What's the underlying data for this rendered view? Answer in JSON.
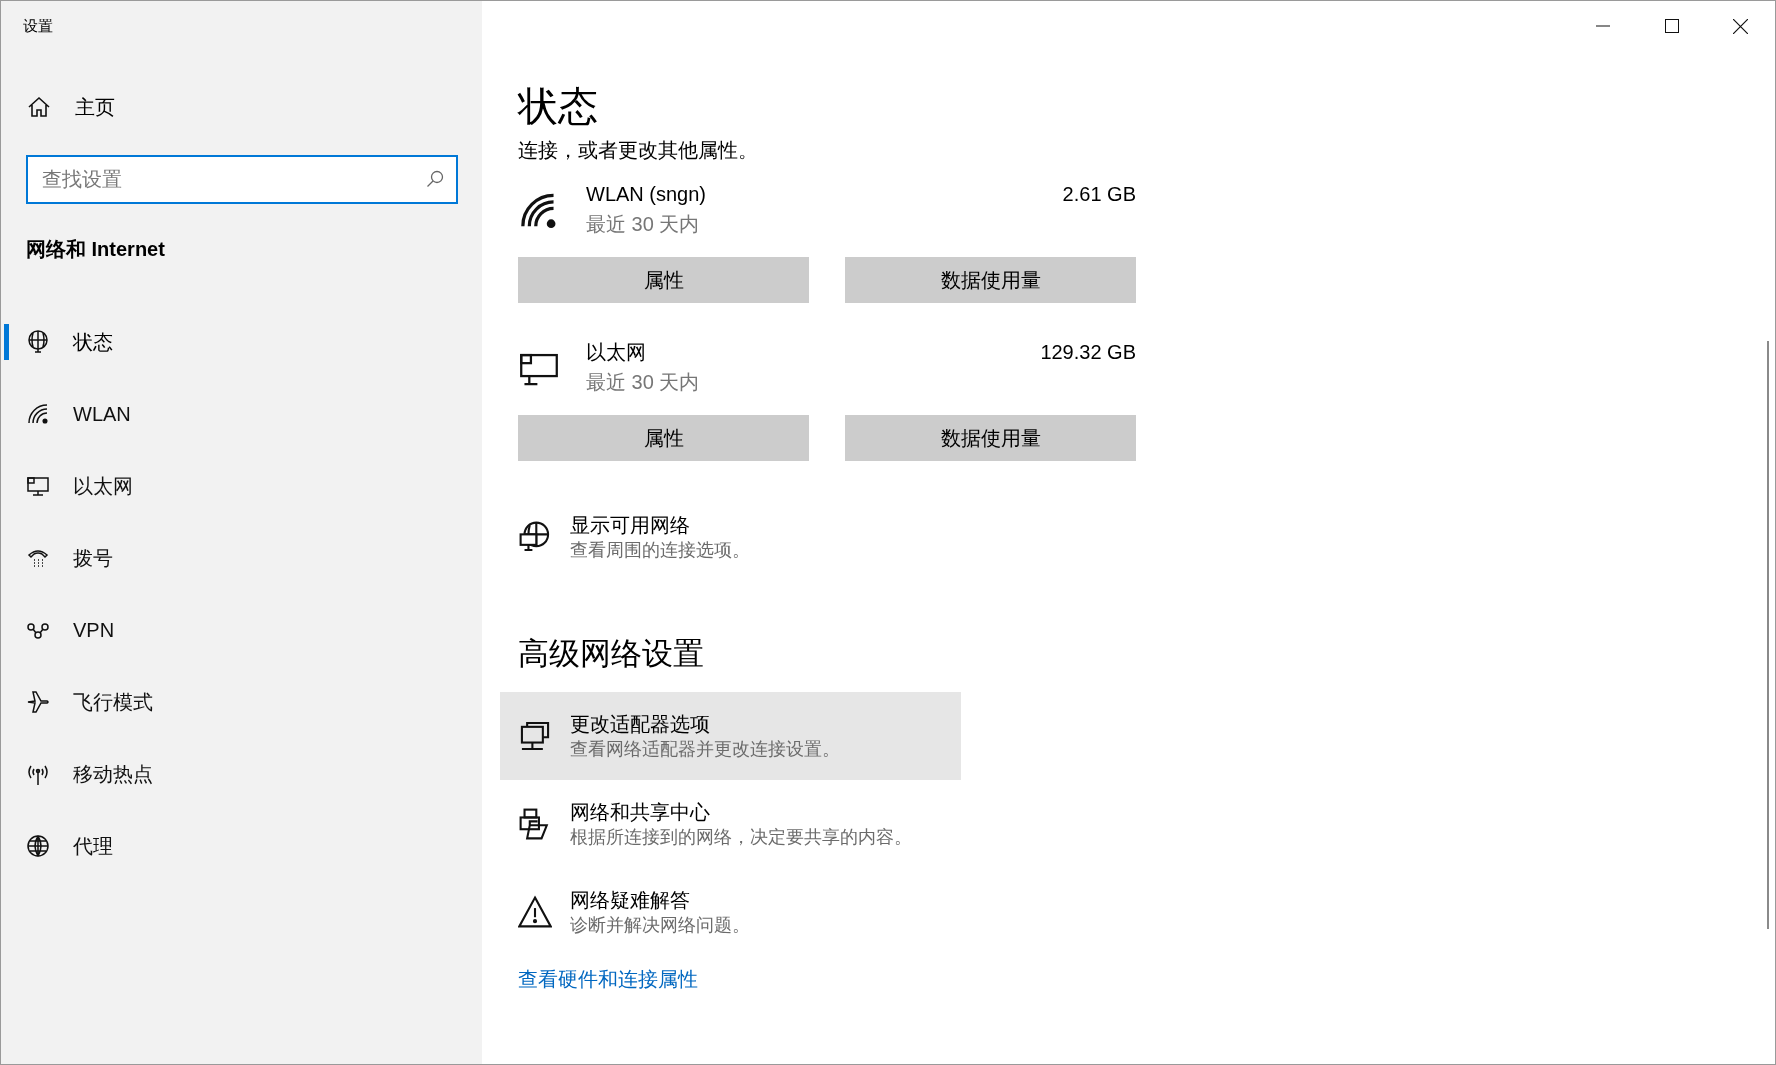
{
  "window": {
    "title": "设置"
  },
  "sidebar": {
    "home": "主页",
    "search": {
      "placeholder": "查找设置"
    },
    "section": "网络和 Internet",
    "items": [
      {
        "label": "状态",
        "selected": true
      },
      {
        "label": "WLAN",
        "selected": false
      },
      {
        "label": "以太网",
        "selected": false
      },
      {
        "label": "拨号",
        "selected": false
      },
      {
        "label": "VPN",
        "selected": false
      },
      {
        "label": "飞行模式",
        "selected": false
      },
      {
        "label": "移动热点",
        "selected": false
      },
      {
        "label": "代理",
        "selected": false
      }
    ]
  },
  "main": {
    "title": "状态",
    "subtitle": "连接，或者更改其他属性。",
    "connections": [
      {
        "name": "WLAN (sngn)",
        "period": "最近 30 天内",
        "usage": "2.61 GB",
        "buttons": [
          "属性",
          "数据使用量"
        ]
      },
      {
        "name": "以太网",
        "period": "最近 30 天内",
        "usage": "129.32 GB",
        "buttons": [
          "属性",
          "数据使用量"
        ]
      }
    ],
    "show_networks": {
      "title": "显示可用网络",
      "description": "查看周围的连接选项。"
    },
    "advanced_heading": "高级网络设置",
    "advanced_items": [
      {
        "title": "更改适配器选项",
        "description": "查看网络适配器并更改连接设置。",
        "hovered": true
      },
      {
        "title": "网络和共享中心",
        "description": "根据所连接到的网络，决定要共享的内容。",
        "hovered": false
      },
      {
        "title": "网络疑难解答",
        "description": "诊断并解决网络问题。",
        "hovered": false
      }
    ],
    "link": "查看硬件和连接属性"
  }
}
